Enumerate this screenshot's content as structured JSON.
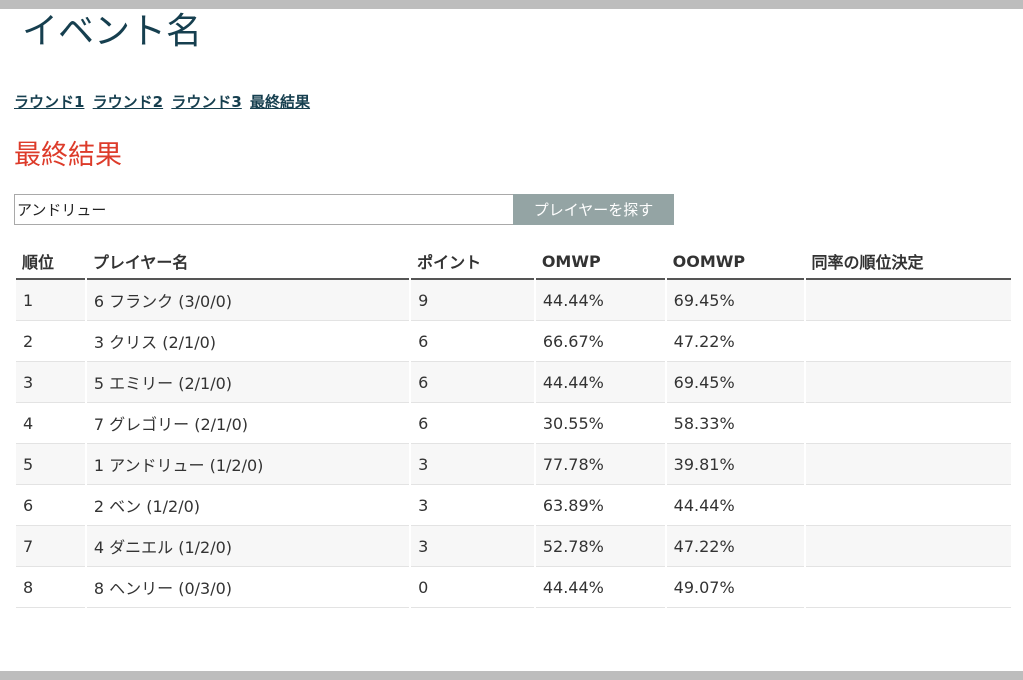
{
  "event": {
    "title": "イベント名"
  },
  "nav": {
    "rounds": [
      "ラウンド1",
      "ラウンド2",
      "ラウンド3",
      "最終結果"
    ]
  },
  "section": {
    "title": "最終結果"
  },
  "search": {
    "value": "アンドリュー",
    "button_label": "プレイヤーを探す"
  },
  "table": {
    "headers": [
      "順位",
      "プレイヤー名",
      "ポイント",
      "OMWP",
      "OOMWP",
      "同率の順位決定"
    ],
    "rows": [
      [
        "1",
        "6 フランク (3/0/0)",
        "9",
        "44.44%",
        "69.45%",
        ""
      ],
      [
        "2",
        "3 クリス (2/1/0)",
        "6",
        "66.67%",
        "47.22%",
        ""
      ],
      [
        "3",
        "5 エミリー (2/1/0)",
        "6",
        "44.44%",
        "69.45%",
        ""
      ],
      [
        "4",
        "7 グレゴリー (2/1/0)",
        "6",
        "30.55%",
        "58.33%",
        ""
      ],
      [
        "5",
        "1 アンドリュー (1/2/0)",
        "3",
        "77.78%",
        "39.81%",
        ""
      ],
      [
        "6",
        "2 ベン (1/2/0)",
        "3",
        "63.89%",
        "44.44%",
        ""
      ],
      [
        "7",
        "4 ダニエル (1/2/0)",
        "3",
        "52.78%",
        "47.22%",
        ""
      ],
      [
        "8",
        "8 ヘンリー (0/3/0)",
        "0",
        "44.44%",
        "49.07%",
        ""
      ]
    ]
  }
}
